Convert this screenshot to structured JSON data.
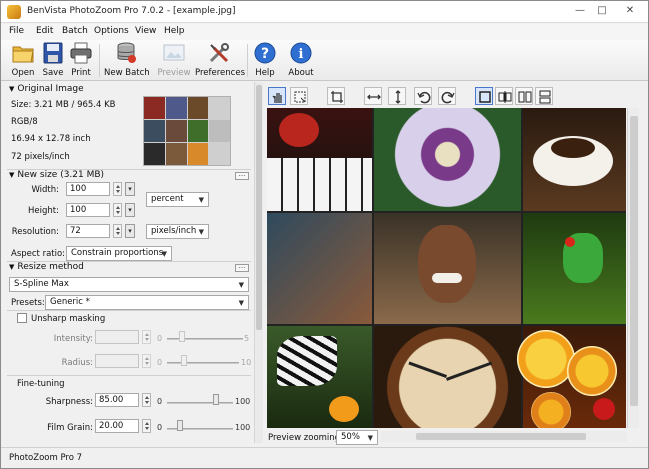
{
  "window": {
    "title": "BenVista PhotoZoom Pro 7.0.2 - [example.jpg]",
    "controls": {
      "minimize": "—",
      "maximize": "□",
      "close": "✕"
    }
  },
  "menu": [
    "File",
    "Edit",
    "Batch",
    "Options",
    "View",
    "Help"
  ],
  "toolbar": {
    "open": "Open",
    "save": "Save",
    "print": "Print",
    "new_batch": "New Batch",
    "preview": "Preview",
    "preferences": "Preferences",
    "help": "Help",
    "about": "About"
  },
  "original_image": {
    "header": "Original Image",
    "size": "Size: 3.21 MB / 965.4 KB",
    "color": "RGB/8",
    "dimensions": "16.94 x 12.78 inch",
    "resolution": "72 pixels/inch"
  },
  "new_size": {
    "header": "New size (3.21 MB)",
    "width_label": "Width:",
    "width_value": "100",
    "height_label": "Height:",
    "height_value": "100",
    "unit": "percent",
    "resolution_label": "Resolution:",
    "resolution_value": "72",
    "resolution_unit": "pixels/inch",
    "aspect_label": "Aspect ratio:",
    "aspect_value": "Constrain proportions"
  },
  "resize_method": {
    "header": "Resize method",
    "method": "S-Spline Max",
    "presets_label": "Presets:",
    "presets_value": "Generic *"
  },
  "unsharp": {
    "label": "Unsharp masking",
    "intensity_label": "Intensity:",
    "intensity_min": "0",
    "intensity_max": "5",
    "radius_label": "Radius:",
    "radius_min": "0",
    "radius_max": "10"
  },
  "fine_tuning": {
    "header": "Fine-tuning",
    "sharpness_label": "Sharpness:",
    "sharpness_value": "85.00",
    "sharpness_min": "0",
    "sharpness_max": "100",
    "film_grain_label": "Film Grain:",
    "film_grain_value": "20.00",
    "film_grain_min": "0",
    "film_grain_max": "100"
  },
  "preview": {
    "zoom_label": "Preview zooming:",
    "zoom_value": "50%"
  },
  "status": "PhotoZoom Pro 7"
}
